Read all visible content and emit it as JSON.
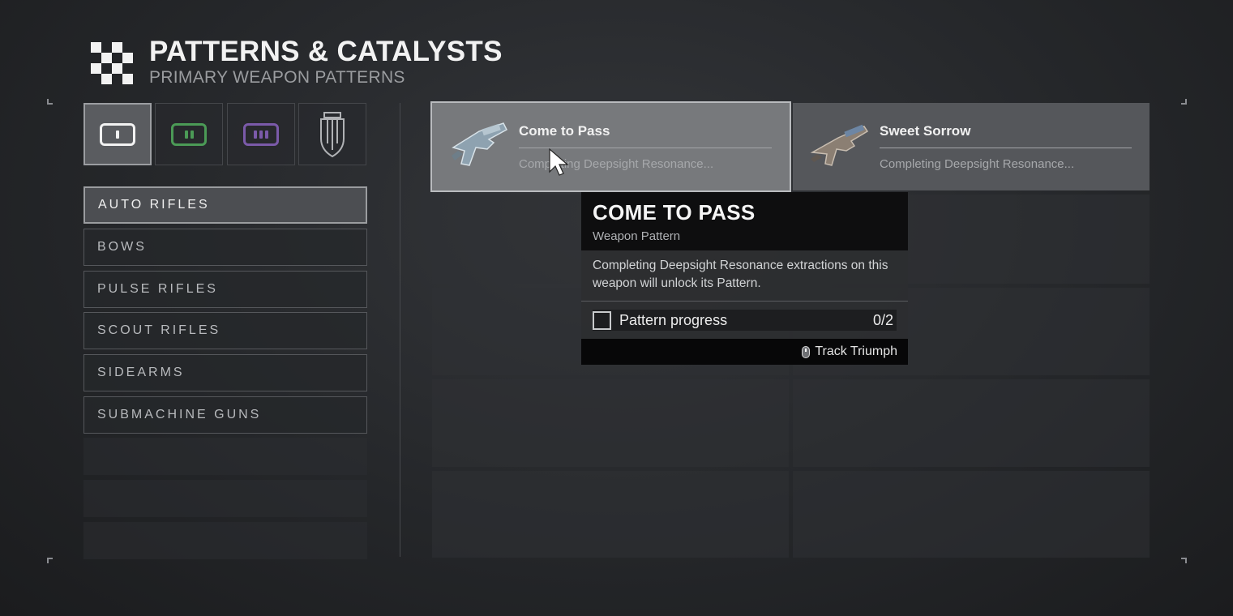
{
  "header": {
    "title": "PATTERNS & CATALYSTS",
    "subtitle": "PRIMARY WEAPON PATTERNS"
  },
  "category_tabs": [
    {
      "name": "primary",
      "selected": true,
      "color": "#f2f2f2"
    },
    {
      "name": "special",
      "selected": false,
      "color": "#4b9a56"
    },
    {
      "name": "heavy",
      "selected": false,
      "color": "#7b5aa9"
    },
    {
      "name": "catalysts",
      "selected": false,
      "color": "#b0b2b5"
    }
  ],
  "weapon_types": [
    {
      "label": "AUTO RIFLES",
      "selected": true
    },
    {
      "label": "BOWS",
      "selected": false
    },
    {
      "label": "PULSE RIFLES",
      "selected": false
    },
    {
      "label": "SCOUT RIFLES",
      "selected": false
    },
    {
      "label": "SIDEARMS",
      "selected": false
    },
    {
      "label": "SUBMACHINE GUNS",
      "selected": false
    }
  ],
  "patterns": [
    {
      "name": "Come to Pass",
      "status": "Completing Deepsight Resonance...",
      "hovered": true
    },
    {
      "name": "Sweet Sorrow",
      "status": "Completing Deepsight Resonance...",
      "hovered": false
    }
  ],
  "tooltip": {
    "title": "COME TO PASS",
    "type": "Weapon Pattern",
    "description": "Completing Deepsight Resonance extractions on this weapon will unlock its Pattern.",
    "progress_label": "Pattern progress",
    "progress_value": "0/2",
    "progress_completed": 0,
    "progress_total": 2,
    "track_label": "Track Triumph"
  }
}
